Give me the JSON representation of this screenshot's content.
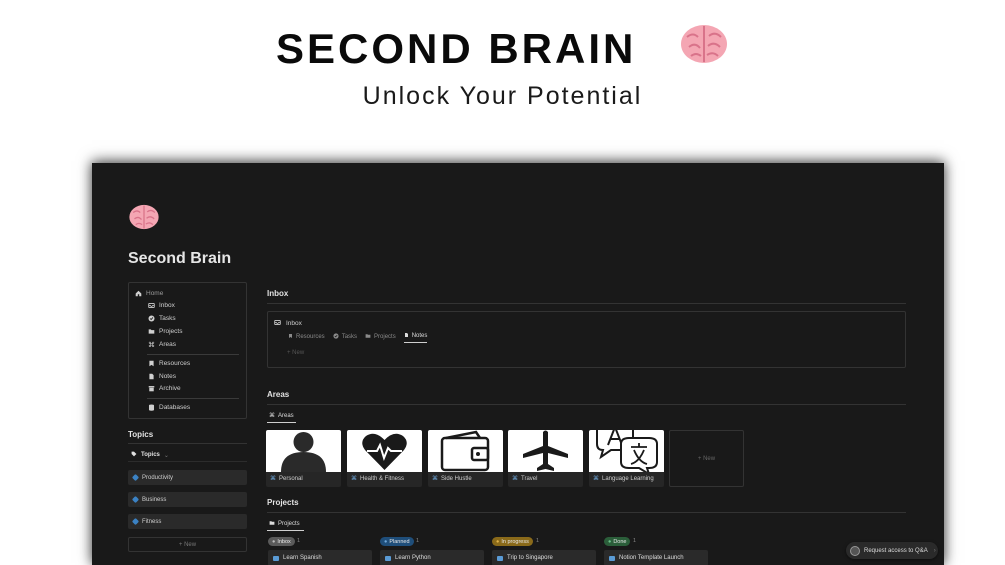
{
  "hero": {
    "title": "SECOND BRAIN",
    "subtitle": "Unlock Your Potential"
  },
  "page": {
    "title": "Second Brain"
  },
  "nav": {
    "home": "Home",
    "items": [
      "Inbox",
      "Tasks",
      "Projects",
      "Areas"
    ],
    "items2": [
      "Resources",
      "Notes",
      "Archive"
    ],
    "databases": "Databases"
  },
  "topics": {
    "title": "Topics",
    "tab": "Topics",
    "items": [
      "Productivity",
      "Business",
      "Fitness"
    ],
    "new": "+ New"
  },
  "inbox": {
    "title": "Inbox",
    "header": "Inbox",
    "tabs": [
      "Resources",
      "Tasks",
      "Projects",
      "Notes"
    ],
    "active_tab": "Notes",
    "new": "+ New"
  },
  "areas": {
    "title": "Areas",
    "tab": "Areas",
    "cards": [
      "Personal",
      "Health & Fitness",
      "Side Hustle",
      "Travel",
      "Language Learning"
    ],
    "new": "+ New"
  },
  "projects": {
    "title": "Projects",
    "tab": "Projects",
    "groups": [
      {
        "status": "Inbox",
        "count": "1",
        "color": "#5a5a5a",
        "item": "Learn Spanish"
      },
      {
        "status": "Planned",
        "count": "1",
        "color": "#1f4e7a",
        "item": "Learn Python"
      },
      {
        "status": "In progress",
        "count": "1",
        "color": "#8a6a1a",
        "item": "Trip to Singapore"
      },
      {
        "status": "Done",
        "count": "1",
        "color": "#2b5e3a",
        "item": "Notion Template Launch"
      }
    ]
  },
  "qa": {
    "label": "Request access to Q&A"
  }
}
